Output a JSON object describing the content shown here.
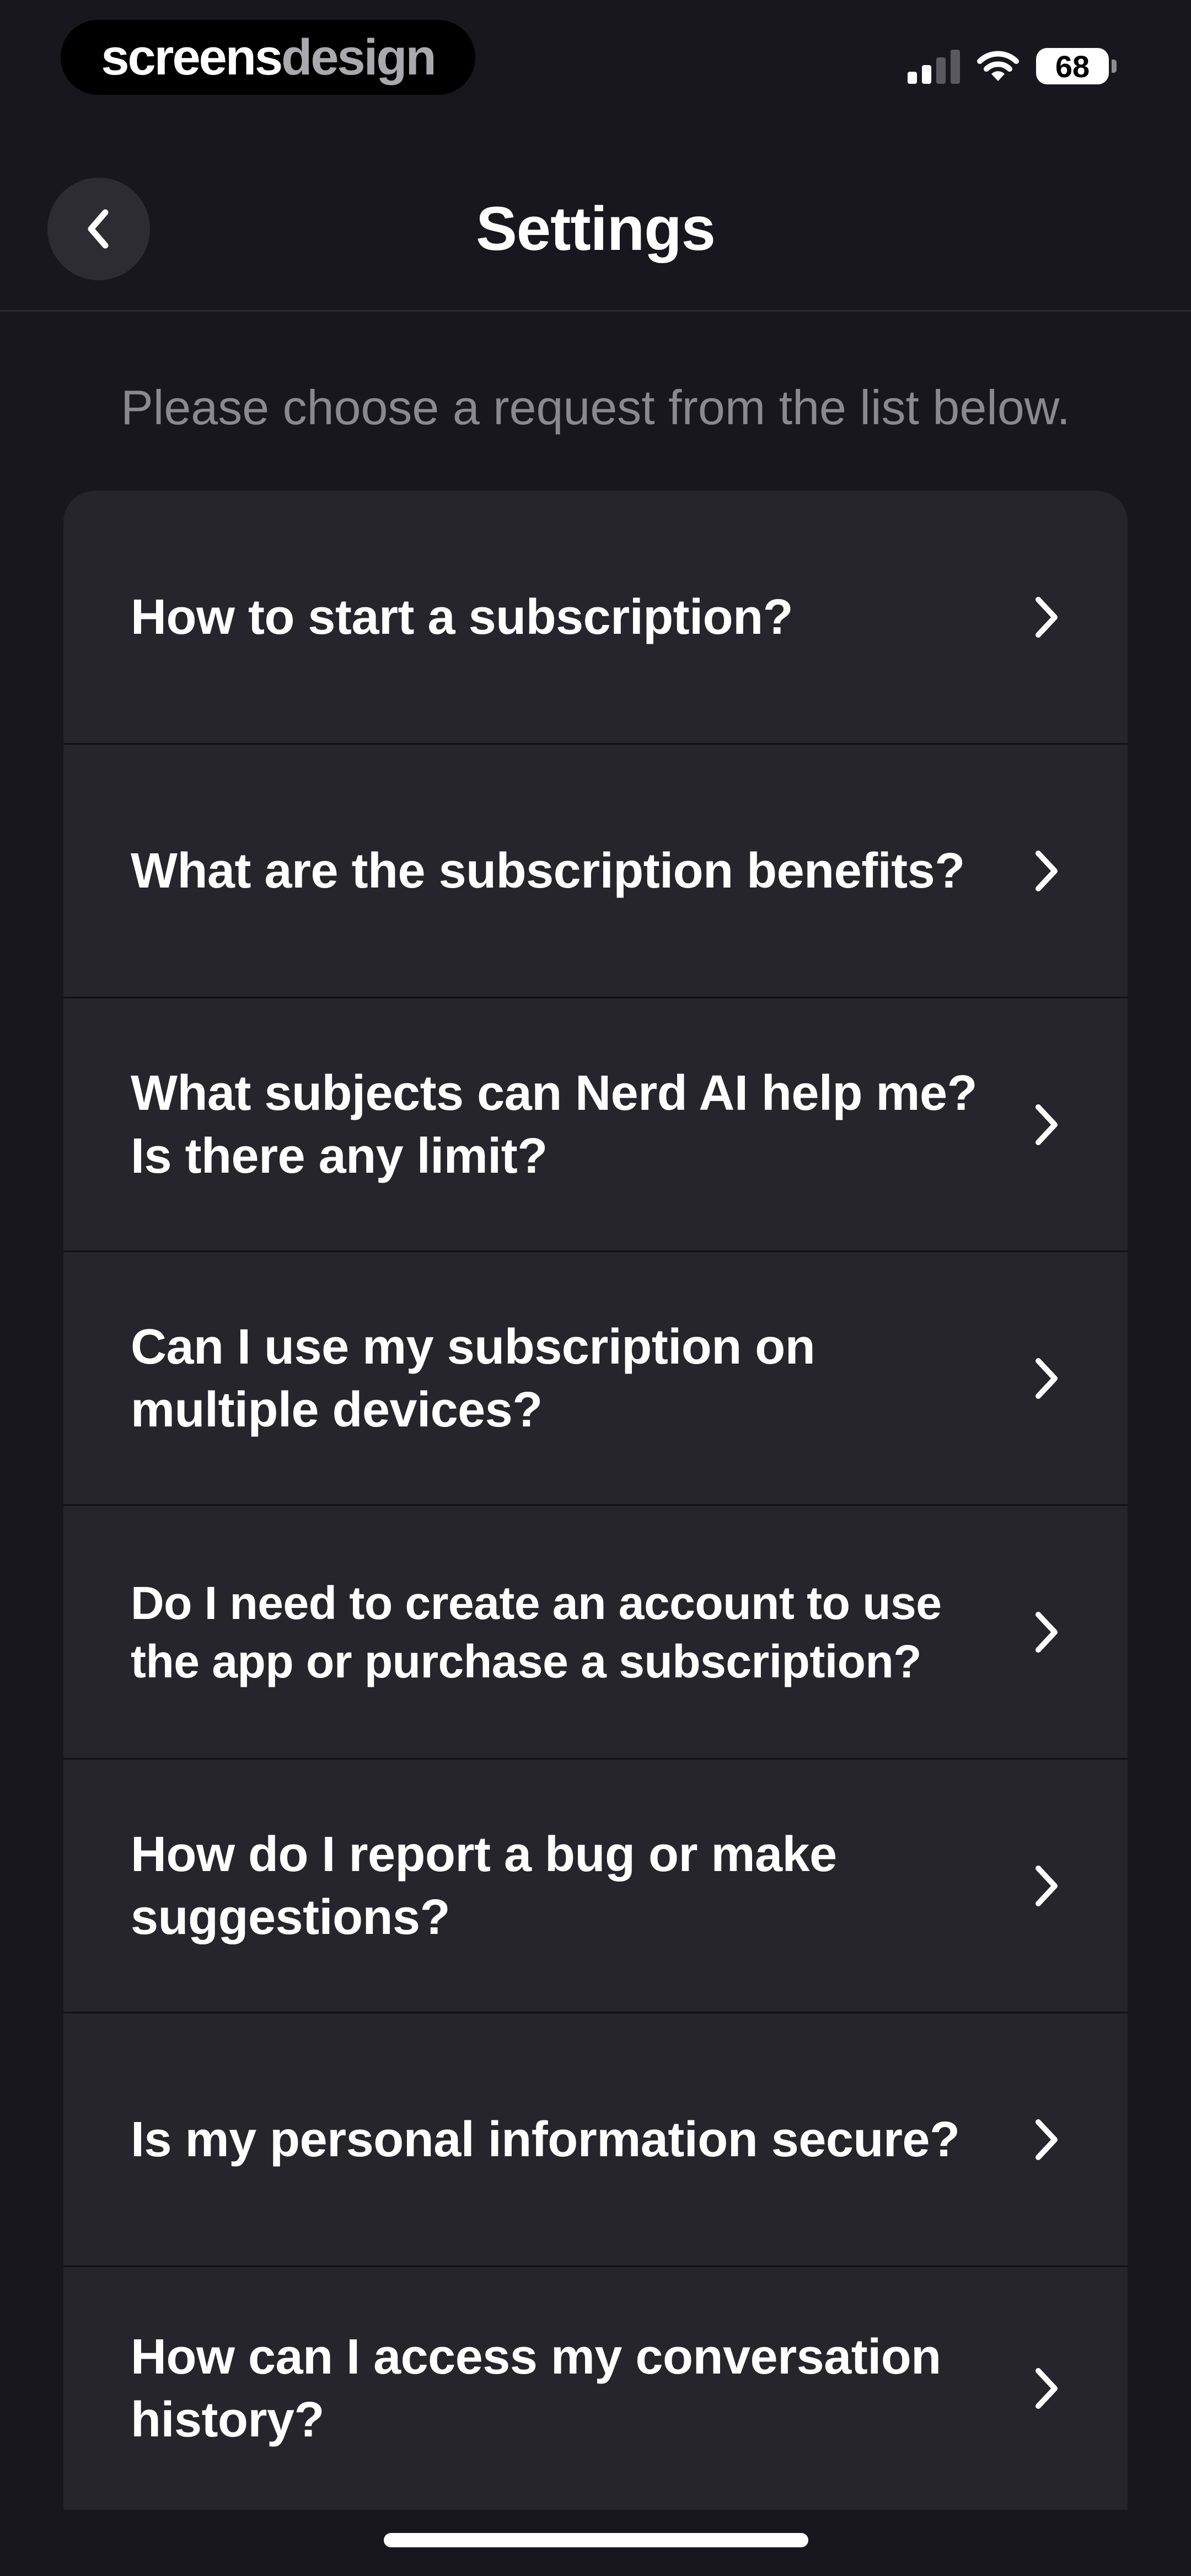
{
  "status_bar": {
    "brand_part1": "screens",
    "brand_part2": "design",
    "battery_level": "68",
    "signal_bars_active": 2,
    "signal_bars_total": 4
  },
  "header": {
    "title": "Settings"
  },
  "intro_text": "Please choose a request from the list below.",
  "faq_items": [
    {
      "label": "How to start a subscription?"
    },
    {
      "label": "What are the subscription benefits?"
    },
    {
      "label": "What subjects can Nerd AI help me? Is there any limit?"
    },
    {
      "label": "Can I use my subscription on multiple devices?"
    },
    {
      "label": "Do I need to create an account to use the app or purchase a subscription?"
    },
    {
      "label": "How do I report a bug or make suggestions?"
    },
    {
      "label": "Is my personal information secure?"
    },
    {
      "label": "How can I access my conversation history?"
    }
  ],
  "icons": {
    "back": "chevron-left-icon",
    "row": "chevron-right-icon"
  },
  "colors": {
    "background": "#18171d",
    "card": "#26252c",
    "muted_text": "#8a8990"
  }
}
